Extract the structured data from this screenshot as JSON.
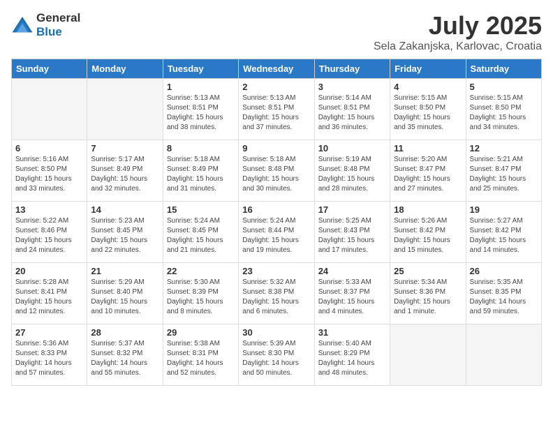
{
  "logo": {
    "general": "General",
    "blue": "Blue"
  },
  "title": "July 2025",
  "location": "Sela Zakanjska, Karlovac, Croatia",
  "headers": [
    "Sunday",
    "Monday",
    "Tuesday",
    "Wednesday",
    "Thursday",
    "Friday",
    "Saturday"
  ],
  "weeks": [
    [
      {
        "date": "",
        "info": ""
      },
      {
        "date": "",
        "info": ""
      },
      {
        "date": "1",
        "info": "Sunrise: 5:13 AM\nSunset: 8:51 PM\nDaylight: 15 hours and 38 minutes."
      },
      {
        "date": "2",
        "info": "Sunrise: 5:13 AM\nSunset: 8:51 PM\nDaylight: 15 hours and 37 minutes."
      },
      {
        "date": "3",
        "info": "Sunrise: 5:14 AM\nSunset: 8:51 PM\nDaylight: 15 hours and 36 minutes."
      },
      {
        "date": "4",
        "info": "Sunrise: 5:15 AM\nSunset: 8:50 PM\nDaylight: 15 hours and 35 minutes."
      },
      {
        "date": "5",
        "info": "Sunrise: 5:15 AM\nSunset: 8:50 PM\nDaylight: 15 hours and 34 minutes."
      }
    ],
    [
      {
        "date": "6",
        "info": "Sunrise: 5:16 AM\nSunset: 8:50 PM\nDaylight: 15 hours and 33 minutes."
      },
      {
        "date": "7",
        "info": "Sunrise: 5:17 AM\nSunset: 8:49 PM\nDaylight: 15 hours and 32 minutes."
      },
      {
        "date": "8",
        "info": "Sunrise: 5:18 AM\nSunset: 8:49 PM\nDaylight: 15 hours and 31 minutes."
      },
      {
        "date": "9",
        "info": "Sunrise: 5:18 AM\nSunset: 8:48 PM\nDaylight: 15 hours and 30 minutes."
      },
      {
        "date": "10",
        "info": "Sunrise: 5:19 AM\nSunset: 8:48 PM\nDaylight: 15 hours and 28 minutes."
      },
      {
        "date": "11",
        "info": "Sunrise: 5:20 AM\nSunset: 8:47 PM\nDaylight: 15 hours and 27 minutes."
      },
      {
        "date": "12",
        "info": "Sunrise: 5:21 AM\nSunset: 8:47 PM\nDaylight: 15 hours and 25 minutes."
      }
    ],
    [
      {
        "date": "13",
        "info": "Sunrise: 5:22 AM\nSunset: 8:46 PM\nDaylight: 15 hours and 24 minutes."
      },
      {
        "date": "14",
        "info": "Sunrise: 5:23 AM\nSunset: 8:45 PM\nDaylight: 15 hours and 22 minutes."
      },
      {
        "date": "15",
        "info": "Sunrise: 5:24 AM\nSunset: 8:45 PM\nDaylight: 15 hours and 21 minutes."
      },
      {
        "date": "16",
        "info": "Sunrise: 5:24 AM\nSunset: 8:44 PM\nDaylight: 15 hours and 19 minutes."
      },
      {
        "date": "17",
        "info": "Sunrise: 5:25 AM\nSunset: 8:43 PM\nDaylight: 15 hours and 17 minutes."
      },
      {
        "date": "18",
        "info": "Sunrise: 5:26 AM\nSunset: 8:42 PM\nDaylight: 15 hours and 15 minutes."
      },
      {
        "date": "19",
        "info": "Sunrise: 5:27 AM\nSunset: 8:42 PM\nDaylight: 15 hours and 14 minutes."
      }
    ],
    [
      {
        "date": "20",
        "info": "Sunrise: 5:28 AM\nSunset: 8:41 PM\nDaylight: 15 hours and 12 minutes."
      },
      {
        "date": "21",
        "info": "Sunrise: 5:29 AM\nSunset: 8:40 PM\nDaylight: 15 hours and 10 minutes."
      },
      {
        "date": "22",
        "info": "Sunrise: 5:30 AM\nSunset: 8:39 PM\nDaylight: 15 hours and 8 minutes."
      },
      {
        "date": "23",
        "info": "Sunrise: 5:32 AM\nSunset: 8:38 PM\nDaylight: 15 hours and 6 minutes."
      },
      {
        "date": "24",
        "info": "Sunrise: 5:33 AM\nSunset: 8:37 PM\nDaylight: 15 hours and 4 minutes."
      },
      {
        "date": "25",
        "info": "Sunrise: 5:34 AM\nSunset: 8:36 PM\nDaylight: 15 hours and 1 minute."
      },
      {
        "date": "26",
        "info": "Sunrise: 5:35 AM\nSunset: 8:35 PM\nDaylight: 14 hours and 59 minutes."
      }
    ],
    [
      {
        "date": "27",
        "info": "Sunrise: 5:36 AM\nSunset: 8:33 PM\nDaylight: 14 hours and 57 minutes."
      },
      {
        "date": "28",
        "info": "Sunrise: 5:37 AM\nSunset: 8:32 PM\nDaylight: 14 hours and 55 minutes."
      },
      {
        "date": "29",
        "info": "Sunrise: 5:38 AM\nSunset: 8:31 PM\nDaylight: 14 hours and 52 minutes."
      },
      {
        "date": "30",
        "info": "Sunrise: 5:39 AM\nSunset: 8:30 PM\nDaylight: 14 hours and 50 minutes."
      },
      {
        "date": "31",
        "info": "Sunrise: 5:40 AM\nSunset: 8:29 PM\nDaylight: 14 hours and 48 minutes."
      },
      {
        "date": "",
        "info": ""
      },
      {
        "date": "",
        "info": ""
      }
    ]
  ]
}
